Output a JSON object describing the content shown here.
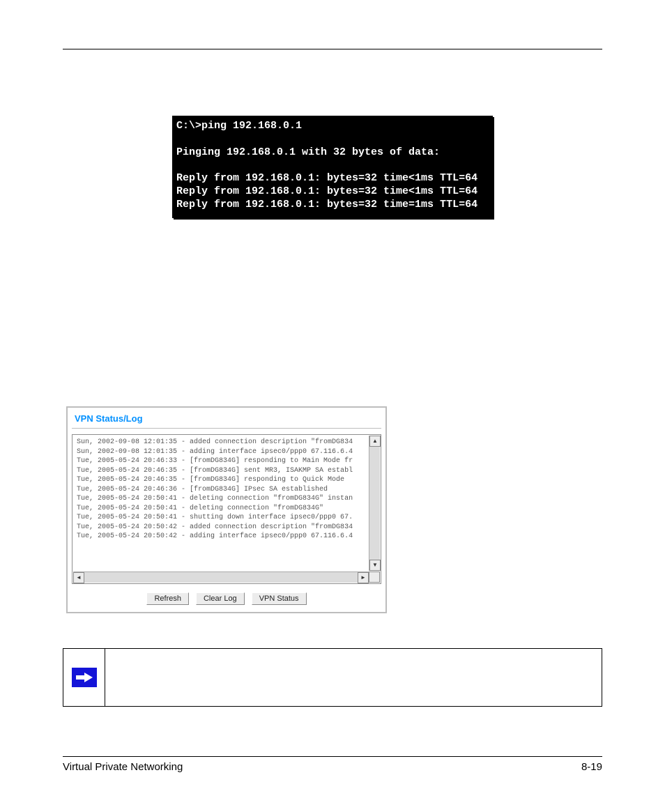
{
  "terminal": {
    "lines": [
      "C:\\>ping 192.168.0.1",
      "",
      "Pinging 192.168.0.1 with 32 bytes of data:",
      "",
      "Reply from 192.168.0.1: bytes=32 time<1ms TTL=64",
      "Reply from 192.168.0.1: bytes=32 time<1ms TTL=64",
      "Reply from 192.168.0.1: bytes=32 time=1ms TTL=64"
    ]
  },
  "vpn": {
    "title": "VPN Status/Log",
    "log_lines": [
      "Sun, 2002-09-08 12:01:35 - added connection description \"fromDG834",
      "Sun, 2002-09-08 12:01:35 - adding interface ipsec0/ppp0 67.116.6.4",
      "Tue, 2005-05-24 20:46:33 - [fromDG834G] responding to Main Mode fr",
      "Tue, 2005-05-24 20:46:35 - [fromDG834G] sent MR3, ISAKMP SA establ",
      "Tue, 2005-05-24 20:46:35 - [fromDG834G] responding to Quick Mode",
      "Tue, 2005-05-24 20:46:36 - [fromDG834G] IPsec SA established",
      "Tue, 2005-05-24 20:50:41 - deleting connection \"fromDG834G\" instan",
      "Tue, 2005-05-24 20:50:41 - deleting connection \"fromDG834G\"",
      "Tue, 2005-05-24 20:50:41 - shutting down interface ipsec0/ppp0 67.",
      "Tue, 2005-05-24 20:50:42 - added connection description \"fromDG834",
      "Tue, 2005-05-24 20:50:42 - adding interface ipsec0/ppp0 67.116.6.4"
    ],
    "buttons": {
      "refresh": "Refresh",
      "clear": "Clear Log",
      "status": "VPN Status"
    }
  },
  "footer": {
    "left": "Virtual Private Networking",
    "right": "8-19"
  }
}
